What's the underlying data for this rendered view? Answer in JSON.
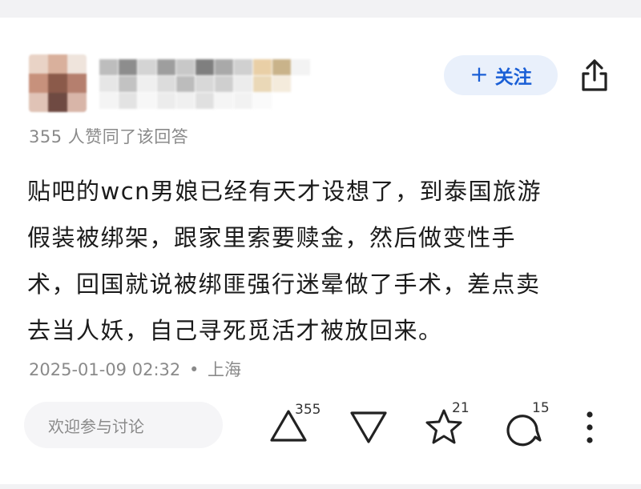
{
  "header": {
    "follow_label": "关注",
    "follow_plus": "+"
  },
  "stats": {
    "likes_text": "355 人赞同了该回答"
  },
  "answer": {
    "lines": [
      "贴吧的wcn男娘已经有天才设想了，到泰国旅游",
      "假装被绑架，跟家里索要赎金，然后做变性手",
      "术，回国就说被绑匪强行迷晕做了手术，差点卖",
      "去当人妖，自己寻死觅活才被放回来。"
    ]
  },
  "meta": {
    "datetime": "2025-01-09 02:32",
    "separator": "•",
    "location": "上海"
  },
  "comment": {
    "placeholder": "欢迎参与讨论"
  },
  "actions": {
    "upvote_count": "355",
    "favorite_count": "21",
    "comment_count": "15"
  },
  "colors": {
    "accent": "#1a5fd6",
    "follow_bg": "#e9f0fb",
    "muted_text": "#8a8a8a"
  },
  "icons": {
    "share": "share-icon",
    "upvote": "upvote-icon",
    "downvote": "downvote-icon",
    "favorite": "star-icon",
    "comment": "comment-icon",
    "more": "more-vertical-icon"
  }
}
